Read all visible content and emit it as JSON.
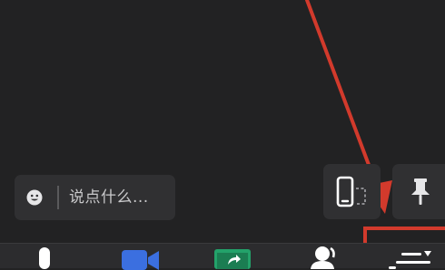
{
  "chat": {
    "placeholder": "说点什么..."
  },
  "icons": {
    "emoji": "smiley-icon",
    "screen_share_phone": "phone-cast-icon",
    "pin": "pin-icon",
    "mic": "microphone-icon",
    "camera": "video-camera-icon",
    "share": "share-screen-icon",
    "participants": "participants-icon",
    "more": "menu-dropdown-icon"
  },
  "colors": {
    "background": "#222223",
    "panel": "#303032",
    "toolbar": "#2c2c2e",
    "annotation_red": "#d23a2c",
    "camera_blue": "#3b6fe0",
    "share_green": "#23a26a"
  }
}
